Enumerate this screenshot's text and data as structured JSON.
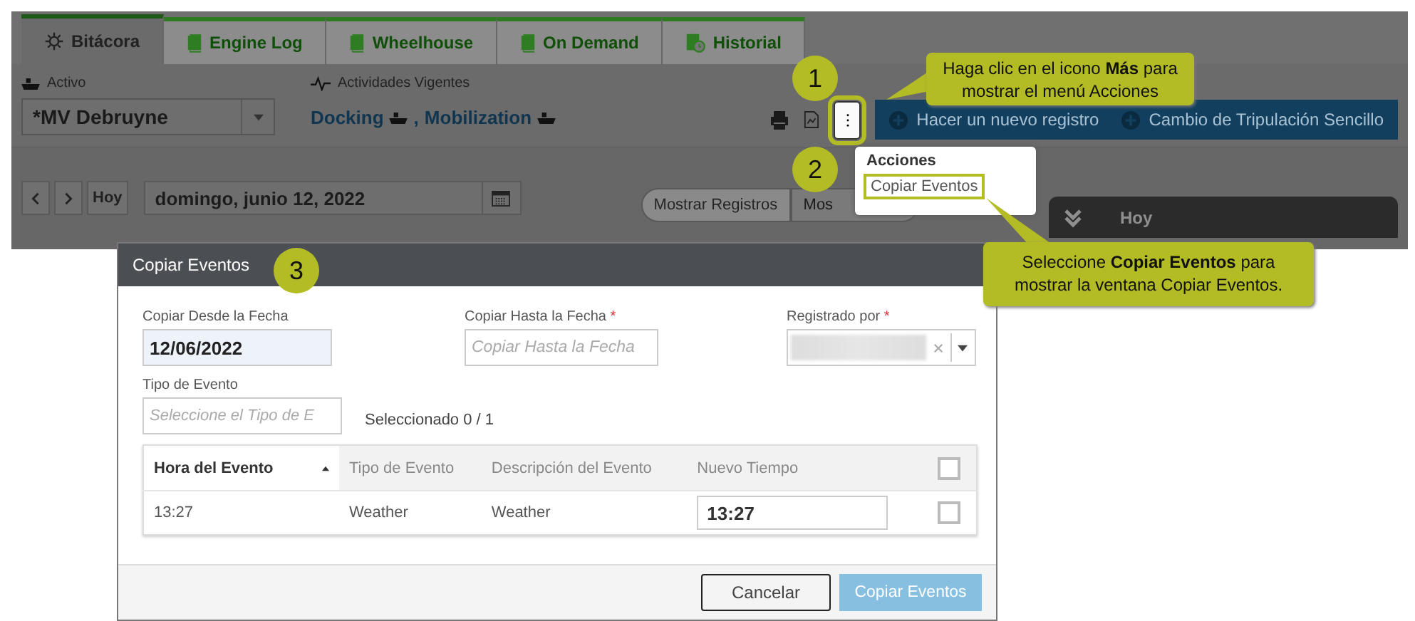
{
  "tabs": [
    {
      "label": "Bitácora",
      "selected": true
    },
    {
      "label": "Engine Log",
      "selected": false
    },
    {
      "label": "Wheelhouse",
      "selected": false
    },
    {
      "label": "On Demand",
      "selected": false
    },
    {
      "label": "Historial",
      "selected": false
    }
  ],
  "asset": {
    "label": "Activo",
    "value": "*MV Debruyne"
  },
  "activities": {
    "label": "Actividades Vigentes",
    "items": [
      {
        "name": "Docking",
        "suffix": ","
      },
      {
        "name": "Mobilization"
      }
    ]
  },
  "toolbar_buttons": [
    "Hacer un nuevo registro",
    "Cambio de Tripulación Sencillo"
  ],
  "date_nav": {
    "today": "Hoy",
    "date": "domingo, junio 12, 2022"
  },
  "view_toggle": [
    {
      "label": "Mostrar Registros",
      "selected": true
    },
    {
      "label": "Mos",
      "selected": false
    }
  ],
  "day_bar": {
    "label": "Hoy"
  },
  "menu": {
    "title": "Acciones",
    "items": [
      {
        "label": "Copiar Eventos",
        "highlighted": true
      }
    ]
  },
  "callouts": [
    {
      "number": "1",
      "text": "Haga clic en el icono **Más** para mostrar el menú Acciones"
    },
    {
      "number": "2",
      "text": "Seleccione **Copiar Eventos** para mostrar la ventana Copiar Eventos."
    },
    {
      "number": "3"
    }
  ],
  "dialog": {
    "title": "Copiar Eventos",
    "fields": [
      {
        "kind": "date",
        "label": "Copiar Desde la Fecha",
        "value": "12/06/2022"
      },
      {
        "kind": "date",
        "label": "Copiar Hasta la Fecha",
        "required_mark": "*",
        "placeholder": "Copiar Hasta la Fecha"
      },
      {
        "kind": "select",
        "label": "Registrado por",
        "required_mark": "*"
      }
    ],
    "event_type": {
      "label": "Tipo de Evento",
      "placeholder": "Seleccione el Tipo de E"
    },
    "selected_count": "Seleccionado 0 / 1",
    "table": {
      "columns": [
        {
          "label": "Hora del Evento",
          "sorted": true
        },
        {
          "label": "Tipo de Evento",
          "sorted": false
        },
        {
          "label": "Descripción del Evento",
          "sorted": false
        },
        {
          "label": "Nuevo Tiempo",
          "sorted": false
        }
      ],
      "all_checked": false,
      "rows": [
        {
          "time": "13:27",
          "type": "Weather",
          "description": "Weather",
          "new_time": "13:27",
          "checked": false
        }
      ]
    },
    "buttons": [
      {
        "label": "Cancelar",
        "kind": "secondary"
      },
      {
        "label": "Copiar Eventos",
        "kind": "primary"
      }
    ]
  }
}
